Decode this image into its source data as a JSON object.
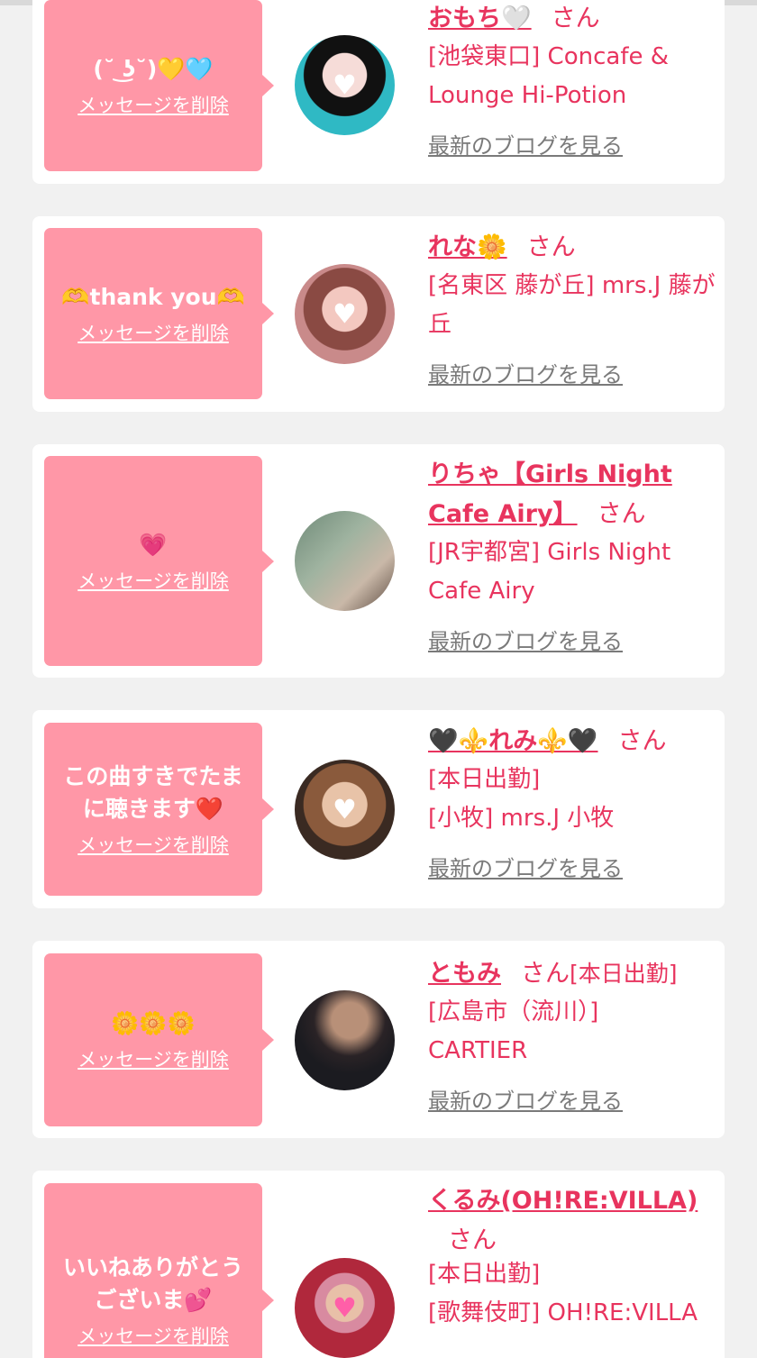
{
  "cards": [
    {
      "message": "(˘ ͜ʖ˘)💛🩵",
      "delete_label": "メッセージを削除",
      "name": "おもち🤍",
      "san": "さん",
      "shop": "[池袋東口] Concafe & Lounge Hi-Potion",
      "blog_label": "最新のブログを見る"
    },
    {
      "message": "🫶thank you🫶",
      "delete_label": "メッセージを削除",
      "name": "れな🌼",
      "san": "さん",
      "shop": "[名東区 藤が丘] mrs.J 藤が丘",
      "blog_label": "最新のブログを見る"
    },
    {
      "message": "💗",
      "delete_label": "メッセージを削除",
      "name": "りちゃ【Girls Night Cafe Airy】",
      "san": "さん",
      "shop": "[JR宇都宮] Girls Night Cafe Airy",
      "blog_label": "最新のブログを見る"
    },
    {
      "message": "この曲すきでたまに聴きます❤️",
      "delete_label": "メッセージを削除",
      "name": "🖤⚜️れみ⚜️🖤",
      "san": "さん",
      "status": "[本日出勤]",
      "shop": "[小牧] mrs.J 小牧",
      "blog_label": "最新のブログを見る"
    },
    {
      "message": "🌼🌼🌼",
      "delete_label": "メッセージを削除",
      "name": "ともみ",
      "san": "さん",
      "status": "[本日出勤]",
      "shop": "[広島市（流川）] CARTIER",
      "blog_label": "最新のブログを見る"
    },
    {
      "message": "いいねありがとうございま💕",
      "delete_label": "メッセージを削除",
      "name": "くるみ(OH!RE:VILLA)",
      "san": "さん",
      "status": "[本日出勤]",
      "shop": "[歌舞伎町] OH!RE:VILLA",
      "blog_label": ""
    }
  ],
  "avatar_colors": [
    "#2fb9c4",
    "#c98a8a",
    "#7f9a84",
    "#a4765e",
    "#1b1b20",
    "#b0283c"
  ]
}
